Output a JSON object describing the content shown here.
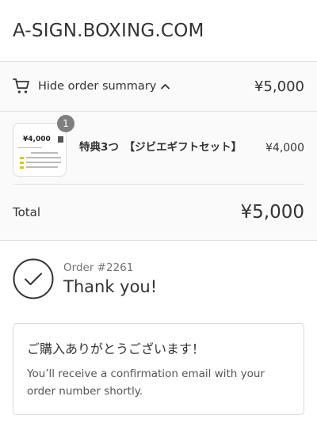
{
  "store": {
    "name": "A-SIGN.BOXING.COM"
  },
  "summary_toggle": {
    "label": "Hide order summary",
    "total": "¥5,000"
  },
  "line_items": [
    {
      "quantity": "1",
      "name": "特典3つ　【ジビエギフトセット】",
      "price": "¥4,000",
      "thumb_price": "¥4,000"
    }
  ],
  "totals": {
    "label": "Total",
    "value": "¥5,000"
  },
  "order": {
    "number": "Order #2261",
    "thank_you": "Thank you!"
  },
  "confirmation": {
    "title": "ご購入ありがとうございます！",
    "body": "You’ll receive a confirmation email with your order number shortly."
  },
  "icons": {
    "cart": "cart-icon",
    "caret": "chevron-up-icon",
    "check": "checkmark-circle-icon"
  }
}
